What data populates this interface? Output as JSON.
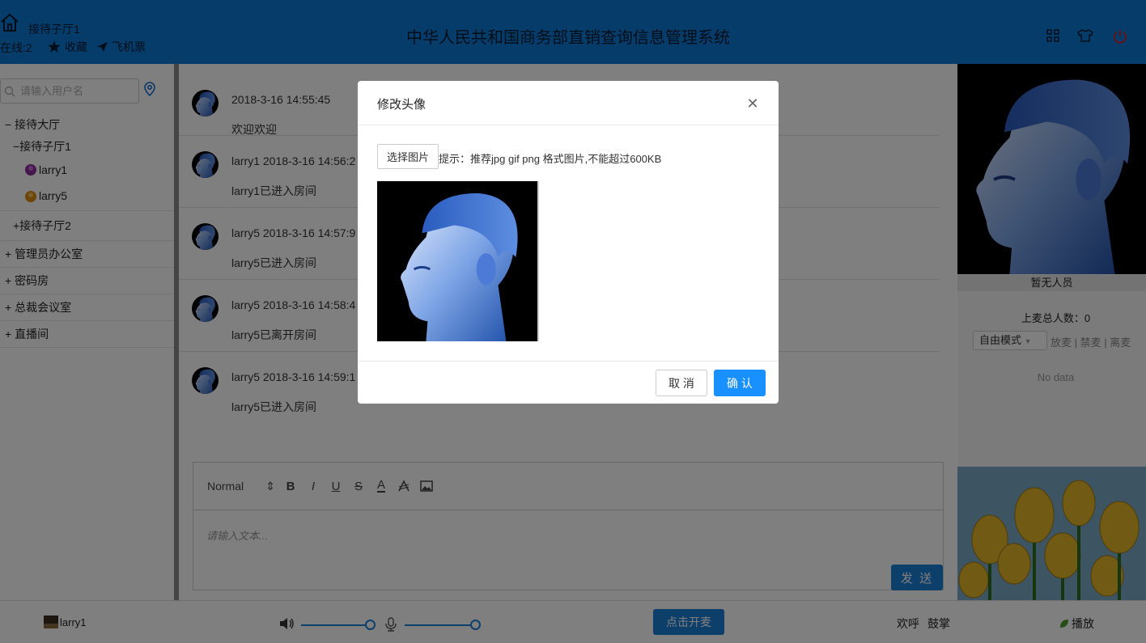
{
  "header": {
    "room_name": "接待子厅1",
    "online": "在线:2",
    "favorite_label": "收藏",
    "ticket_label": "飞机票",
    "title": "中华人民共和国商务部直销查询信息管理系统"
  },
  "sidebar": {
    "search_placeholder": "请输入用户名",
    "tree": [
      {
        "prefix": "−",
        "label": "接待大厅"
      },
      {
        "prefix": "−",
        "label": "接待子厅1"
      },
      {
        "label": "larry1"
      },
      {
        "label": "larry5"
      },
      {
        "prefix": "+",
        "label": "接待子厅2"
      },
      {
        "prefix": "+",
        "label": "管理员办公室"
      },
      {
        "prefix": "+",
        "label": "密码房"
      },
      {
        "prefix": "+",
        "label": "总裁会议室"
      },
      {
        "prefix": "+",
        "label": "直播间"
      }
    ]
  },
  "messages": [
    {
      "meta": "2018-3-16 14:55:45",
      "text": "欢迎欢迎"
    },
    {
      "meta": "larry1 2018-3-16 14:56:2",
      "text": "larry1已进入房间"
    },
    {
      "meta": "larry5 2018-3-16 14:57:9",
      "text": "larry5已进入房间"
    },
    {
      "meta": "larry5 2018-3-16 14:58:4",
      "text": "larry5已离开房间"
    },
    {
      "meta": "larry5 2018-3-16 14:59:1",
      "text": "larry5已进入房间"
    }
  ],
  "editor": {
    "format": "Normal",
    "placeholder": "请输入文本...",
    "send_label": "发 送"
  },
  "right_panel": {
    "nobody": "暂无人员",
    "mic_count": "上麦总人数：0",
    "mode": "自由模式",
    "mic_actions": "放麦 | 禁麦 | 离麦",
    "no_data": "No data"
  },
  "footer": {
    "user": "larry1",
    "open_mic": "点击开麦",
    "welcome": "欢呼",
    "clap": "鼓掌",
    "play": "播放"
  },
  "modal": {
    "title": "修改头像",
    "choose_label": "选择图片",
    "hint": "提示：推荐jpg gif png 格式图片,不能超过600KB",
    "cancel_label": "取 消",
    "ok_label": "确 认"
  },
  "colors": {
    "brand": "#0a78d4",
    "primary_button": "#1890ff"
  }
}
